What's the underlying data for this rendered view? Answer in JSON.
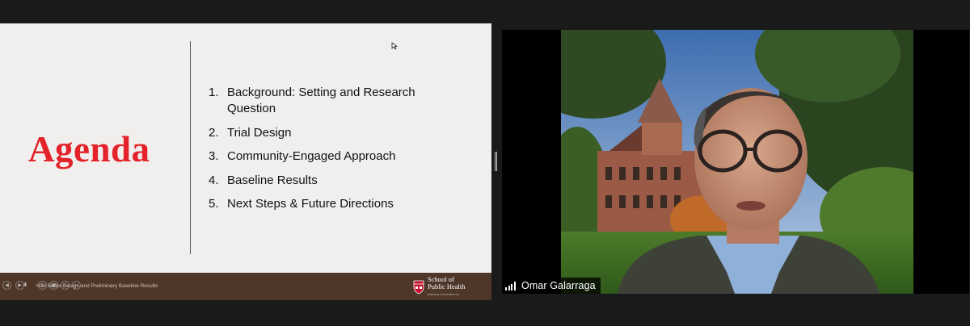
{
  "slide": {
    "title": "Agenda",
    "agenda_items": [
      {
        "num": "1.",
        "text": "Background: Setting and Research Question"
      },
      {
        "num": "2.",
        "text": "Trial Design"
      },
      {
        "num": "3.",
        "text": "Community-Engaged Approach"
      },
      {
        "num": "4.",
        "text": "Baseline Results"
      },
      {
        "num": "5.",
        "text": "Next Steps & Future Directions"
      }
    ],
    "footer": {
      "slide_number": "4",
      "text": "Hair Better Design and Preliminary Baseline Results",
      "logo_line1": "School of",
      "logo_line2": "Public Health",
      "logo_sub": "BROWN UNIVERSITY"
    }
  },
  "video": {
    "participant_name": "Omar Galarraga"
  },
  "colors": {
    "accent_red": "#e3222a",
    "footer_brown": "#4e3629",
    "slide_bg": "#f1efed"
  }
}
